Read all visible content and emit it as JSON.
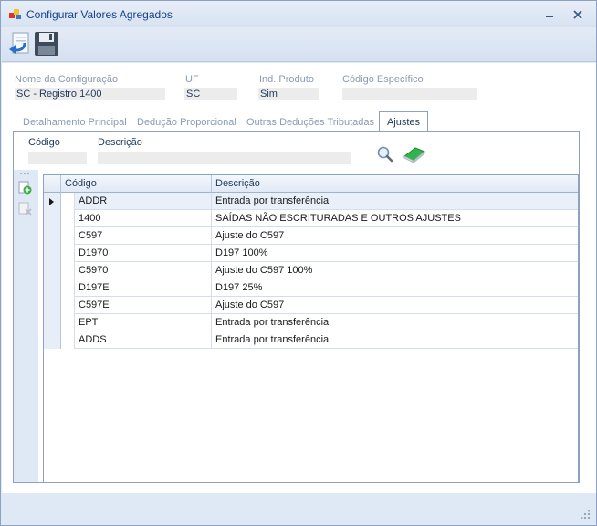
{
  "window": {
    "title": "Configurar Valores Agregados",
    "minimize_icon": "minimize-icon",
    "close_icon": "close-icon"
  },
  "toolbar": {
    "undo_icon": "undo-arrow-icon",
    "save_icon": "floppy-disk-icon"
  },
  "header": {
    "nome_label": "Nome da Configuração",
    "nome_value": "SC - Registro 1400",
    "uf_label": "UF",
    "uf_value": "SC",
    "ind_label": "Ind. Produto",
    "ind_value": "Sim",
    "codigo_esp_label": "Código Específico",
    "codigo_esp_value": ""
  },
  "tabs": [
    {
      "label": "Detalhamento Principal",
      "active": false
    },
    {
      "label": "Dedução Proporcional",
      "active": false
    },
    {
      "label": "Outras Deduções Tributadas",
      "active": false
    },
    {
      "label": "Ajustes",
      "active": true
    }
  ],
  "filter": {
    "codigo_label": "Código",
    "codigo_value": "",
    "descricao_label": "Descrição",
    "descricao_value": "",
    "search_icon": "magnifier-icon",
    "clear_icon": "eraser-icon"
  },
  "grid": {
    "columns": [
      "Código",
      "Descrição"
    ],
    "rows": [
      {
        "codigo": "ADDR",
        "descricao": "Entrada por transferência"
      },
      {
        "codigo": "1400",
        "descricao": "SAÍDAS NÃO ESCRITURADAS E OUTROS AJUSTES"
      },
      {
        "codigo": "C597",
        "descricao": "Ajuste do C597"
      },
      {
        "codigo": "D1970",
        "descricao": "D197 100%"
      },
      {
        "codigo": "C5970",
        "descricao": "Ajuste do C597 100%"
      },
      {
        "codigo": "D197E",
        "descricao": "D197 25%"
      },
      {
        "codigo": "C597E",
        "descricao": "Ajuste do C597"
      },
      {
        "codigo": "EPT",
        "descricao": "Entrada por transferência"
      },
      {
        "codigo": "ADDS",
        "descricao": "Entrada por transferência"
      }
    ],
    "side_tools": [
      "add-row-icon",
      "delete-row-icon"
    ]
  }
}
